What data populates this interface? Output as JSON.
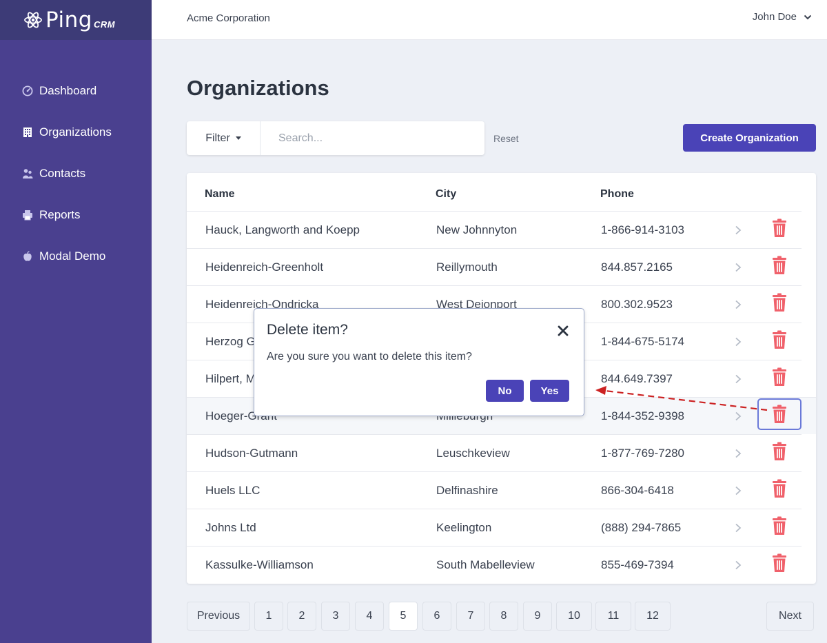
{
  "brand": {
    "name": "Ping",
    "suffix": "CRM"
  },
  "header": {
    "company": "Acme Corporation",
    "user": "John Doe"
  },
  "sidebar": {
    "items": [
      {
        "label": "Dashboard",
        "icon": "gauge-icon"
      },
      {
        "label": "Organizations",
        "icon": "building-icon"
      },
      {
        "label": "Contacts",
        "icon": "users-icon"
      },
      {
        "label": "Reports",
        "icon": "printer-icon"
      },
      {
        "label": "Modal Demo",
        "icon": "apple-icon"
      }
    ]
  },
  "page": {
    "title": "Organizations",
    "filter_label": "Filter",
    "search_placeholder": "Search...",
    "search_value": "",
    "reset_label": "Reset",
    "create_label": "Create Organization"
  },
  "table": {
    "columns": [
      "Name",
      "City",
      "Phone"
    ],
    "rows": [
      {
        "name": "Hauck, Langworth and Koepp",
        "city": "New Johnnyton",
        "phone": "1-866-914-3103"
      },
      {
        "name": "Heidenreich-Greenholt",
        "city": "Reillymouth",
        "phone": "844.857.2165"
      },
      {
        "name": "Heidenreich-Ondricka",
        "city": "West Dejonport",
        "phone": "800.302.9523"
      },
      {
        "name": "Herzog G",
        "city": "",
        "phone": "1-844-675-5174"
      },
      {
        "name": "Hilpert, M",
        "city": "",
        "phone": "844.649.7397"
      },
      {
        "name": "Hoeger-Grant",
        "city": "Millieburgh",
        "phone": "1-844-352-9398"
      },
      {
        "name": "Hudson-Gutmann",
        "city": "Leuschkeview",
        "phone": "1-877-769-7280"
      },
      {
        "name": "Huels LLC",
        "city": "Delfinashire",
        "phone": "866-304-6418"
      },
      {
        "name": "Johns Ltd",
        "city": "Keelington",
        "phone": "(888) 294-7865"
      },
      {
        "name": "Kassulke-Williamson",
        "city": "South Mabelleview",
        "phone": "855-469-7394"
      }
    ]
  },
  "pagination": {
    "previous": "Previous",
    "next": "Next",
    "pages": [
      "1",
      "2",
      "3",
      "4",
      "5",
      "6",
      "7",
      "8",
      "9",
      "10",
      "11",
      "12"
    ],
    "current": "5"
  },
  "modal": {
    "title": "Delete item?",
    "message": "Are you sure you want to delete this item?",
    "no_label": "No",
    "yes_label": "Yes"
  },
  "colors": {
    "sidebar": "#4a408f",
    "logo_bar": "#3d3b77",
    "accent": "#4a43b7",
    "danger": "#f0616b",
    "background": "#edf0f6",
    "annotation_arrow": "#cc2222"
  }
}
